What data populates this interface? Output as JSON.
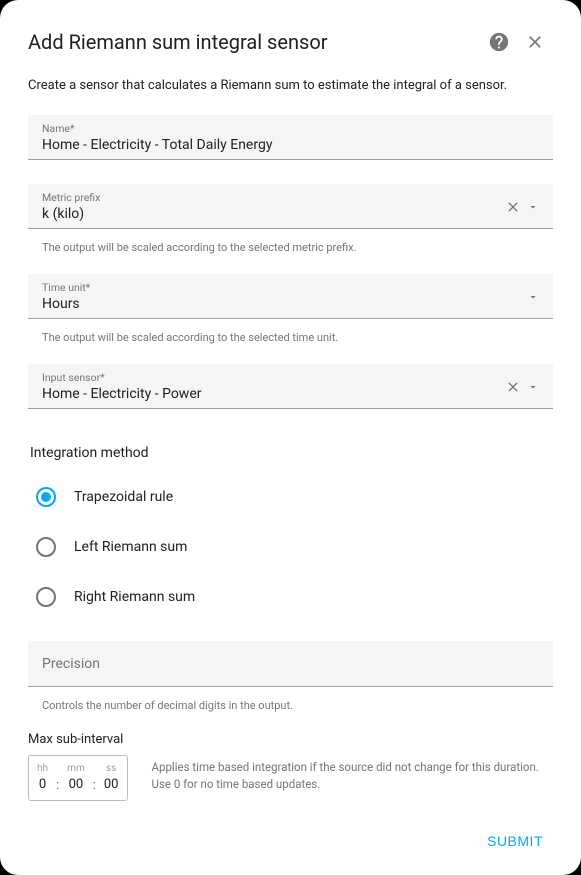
{
  "header": {
    "title": "Add Riemann sum integral sensor"
  },
  "description": "Create a sensor that calculates a Riemann sum to estimate the integral of a sensor.",
  "fields": {
    "name": {
      "label": "Name*",
      "value": "Home - Electricity - Total Daily Energy"
    },
    "metric_prefix": {
      "label": "Metric prefix",
      "value": "k (kilo)",
      "helper": "The output will be scaled according to the selected metric prefix."
    },
    "time_unit": {
      "label": "Time unit*",
      "value": "Hours",
      "helper": "The output will be scaled according to the selected time unit."
    },
    "input_sensor": {
      "label": "Input sensor*",
      "value": "Home - Electricity - Power"
    },
    "precision": {
      "label": "Precision",
      "helper": "Controls the number of decimal digits in the output."
    }
  },
  "integration_method": {
    "section_label": "Integration method",
    "options": [
      {
        "label": "Trapezoidal rule",
        "selected": true
      },
      {
        "label": "Left Riemann sum",
        "selected": false
      },
      {
        "label": "Right Riemann sum",
        "selected": false
      }
    ]
  },
  "max_sub_interval": {
    "label": "Max sub-interval",
    "hh_label": "hh",
    "hh_value": "0",
    "mm_label": "mm",
    "mm_value": "00",
    "ss_label": "ss",
    "ss_value": "00",
    "description_line1": "Applies time based integration if the source did not change for this duration.",
    "description_line2": "Use 0 for no time based updates."
  },
  "footer": {
    "submit": "SUBMIT"
  }
}
